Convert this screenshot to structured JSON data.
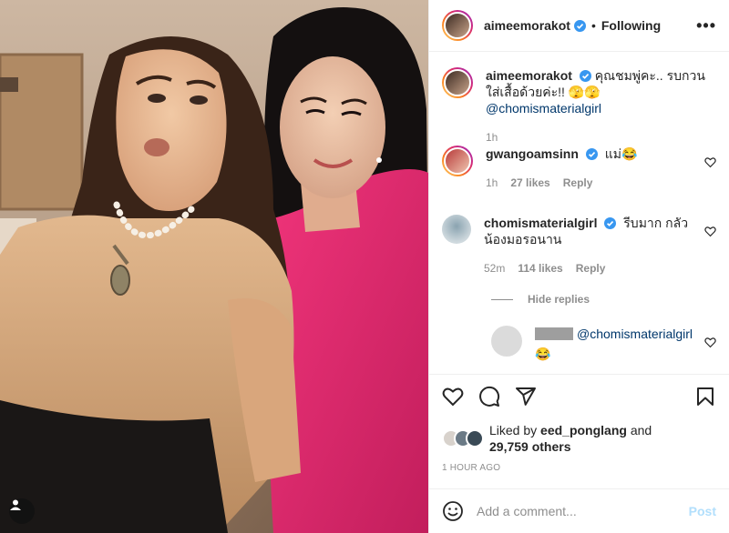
{
  "header": {
    "username": "aimeemorakot",
    "separator": "•",
    "follow_status": "Following",
    "more_label": "•••"
  },
  "comments": [
    {
      "username": "aimeemorakot",
      "text": "คุณชมพู่คะ.. รบกวนใส่เสื้อด้วยค่ะ!! 🫣🫣 ",
      "mention": "@chomismaterialgirl",
      "time": "1h"
    },
    {
      "username": "gwangoamsinn",
      "text": "แม่😂",
      "time": "1h",
      "likes": "27 likes",
      "reply_label": "Reply"
    },
    {
      "username": "chomismaterialgirl",
      "text": "รีบมาก กลัวน้องมอรอนาน",
      "time": "52m",
      "likes": "114 likes",
      "reply_label": "Reply"
    }
  ],
  "hide_replies_label": "Hide replies",
  "reply": {
    "mention": "@chomismaterialgirl",
    "emoji": "😂"
  },
  "likes": {
    "prefix": "Liked by ",
    "first_liker": "eed_ponglang",
    "conj": " and",
    "others": "29,759 others"
  },
  "post_age": "1 HOUR AGO",
  "comment_box": {
    "placeholder": "Add a comment...",
    "post_label": "Post"
  },
  "icons": {
    "verified": "verified-badge-icon",
    "heart": "heart-icon",
    "comment": "comment-icon",
    "share": "share-icon",
    "save": "bookmark-icon",
    "emoji": "emoji-icon",
    "user_tag": "user-tag-icon"
  },
  "colors": {
    "verified": "#3897f0",
    "mention": "#00376b",
    "muted": "#8e8e8e",
    "post_disabled": "#b2dffc",
    "border": "#efefef"
  }
}
